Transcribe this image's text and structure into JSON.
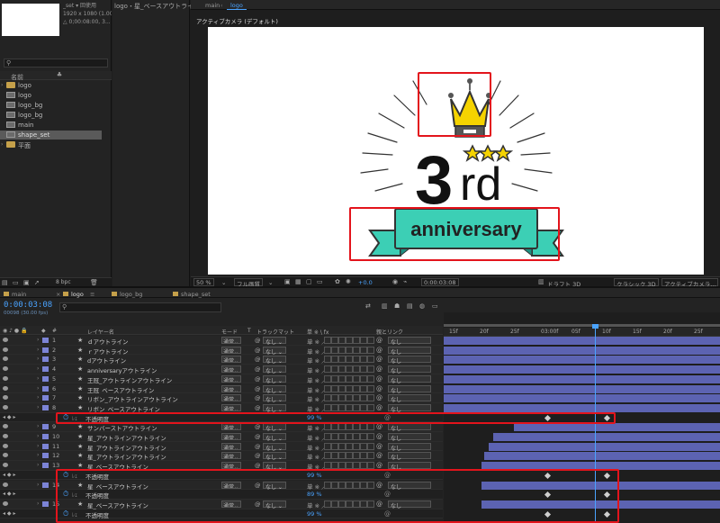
{
  "project": {
    "meta": [
      "_set ▾ 回使用",
      "1920 x 1080 (1.00)",
      "△ 0;00:08:00, 3..."
    ],
    "column_name": "名前",
    "items": [
      {
        "type": "folder",
        "label": "logo",
        "twirl": "›"
      },
      {
        "type": "comp",
        "label": "logo",
        "twirl": ""
      },
      {
        "type": "comp",
        "label": "logo_bg",
        "twirl": ""
      },
      {
        "type": "comp",
        "label": "logo_bg",
        "twirl": ""
      },
      {
        "type": "comp",
        "label": "main",
        "twirl": ""
      },
      {
        "type": "comp",
        "label": "shape_set",
        "twirl": "",
        "selected": true
      },
      {
        "type": "folder",
        "label": "平面",
        "twirl": "›"
      }
    ],
    "bpc": "8 bpc"
  },
  "effects": {
    "title": "logo・星_ベースアウトライン"
  },
  "viewer": {
    "tabs": [
      "main",
      "logo"
    ],
    "active_tab": "logo",
    "camera_label": "アクティブカメラ (デフォルト)",
    "zoom": "50 %",
    "resolution": "フル画質",
    "exposure": "+0.0",
    "time": "0:00:03:08",
    "renderer": "ドラフト 3D",
    "renderer_mode": "クラシック 3D",
    "camera_select": "アクティブカメラ...",
    "artwork": {
      "numeral": "3",
      "suffix": "rd",
      "banner": "anniversary"
    }
  },
  "timeline": {
    "tabs": [
      {
        "label": "main",
        "active": false
      },
      {
        "label": "logo",
        "active": true
      },
      {
        "label": "logo_bg",
        "active": false
      },
      {
        "label": "shape_set",
        "active": false
      }
    ],
    "timecode": "0:00:03:08",
    "fps": "00098 (30.00 fps)",
    "columns": {
      "num": "#",
      "name": "レイヤー名",
      "mode": "モード",
      "t": "T",
      "track": "トラックマット",
      "switches": "単 ※ \\ fx",
      "parent": "親とリンク"
    },
    "ruler": [
      "15f",
      "20f",
      "25f",
      "03:00f",
      "05f",
      "10f",
      "15f",
      "20f",
      "25f"
    ],
    "rows": [
      {
        "kind": "layer",
        "num": "1",
        "name": "ｄアウトライン",
        "mode": "通常",
        "track": "なし",
        "switch": "单 ※ ／",
        "parent": "なし"
      },
      {
        "kind": "layer",
        "num": "2",
        "name": "ｒアウトライン",
        "mode": "通常",
        "track": "なし",
        "switch": "单 ※ ／",
        "parent": "なし"
      },
      {
        "kind": "layer",
        "num": "3",
        "name": "dアウトライン",
        "mode": "通常",
        "track": "なし",
        "switch": "单 ※ ／",
        "parent": "なし"
      },
      {
        "kind": "layer",
        "num": "4",
        "name": "anniversaryアウトライン",
        "mode": "通常",
        "track": "なし",
        "switch": "单 ※ ／",
        "parent": "なし"
      },
      {
        "kind": "layer",
        "num": "5",
        "name": "王冠_アウトラインアウトライン",
        "mode": "通常",
        "track": "なし",
        "switch": "单 ※ ／",
        "parent": "なし"
      },
      {
        "kind": "layer",
        "num": "6",
        "name": "王冠_ベースアウトライン",
        "mode": "通常",
        "track": "なし",
        "switch": "单 ※ ／",
        "parent": "なし"
      },
      {
        "kind": "layer",
        "num": "7",
        "name": "リボン_アウトラインアウトライン",
        "mode": "通常",
        "track": "なし",
        "switch": "单 ※ ／",
        "parent": "なし"
      },
      {
        "kind": "layer",
        "num": "8",
        "name": "リボン_ベースアウトライン",
        "mode": "通常",
        "track": "なし",
        "switch": "单 ※ ／",
        "parent": "なし"
      },
      {
        "kind": "prop",
        "name": "不透明度",
        "value": "99 %"
      },
      {
        "kind": "layer",
        "num": "9",
        "name": "サンバーストアウトライン",
        "mode": "通常",
        "track": "なし",
        "switch": "单 ※ ／",
        "parent": "なし"
      },
      {
        "kind": "layer",
        "num": "10",
        "name": "星_アウトラインアウトライン",
        "mode": "通常",
        "track": "なし",
        "switch": "单 ※ ／",
        "parent": "なし"
      },
      {
        "kind": "layer",
        "num": "11",
        "name": "星_アウトラインアウトライン",
        "mode": "通常",
        "track": "なし",
        "switch": "单 ※ ／",
        "parent": "なし"
      },
      {
        "kind": "layer",
        "num": "12",
        "name": "星_アウトラインアウトライン",
        "mode": "通常",
        "track": "なし",
        "switch": "单 ※ ／",
        "parent": "なし"
      },
      {
        "kind": "layer",
        "num": "13",
        "name": "星_ベースアウトライン",
        "mode": "通常",
        "track": "なし",
        "switch": "单 ※ ／",
        "parent": "なし"
      },
      {
        "kind": "prop",
        "name": "不透明度",
        "value": "99 %"
      },
      {
        "kind": "layer",
        "num": "14",
        "name": "星_ベースアウトライン",
        "mode": "通常",
        "track": "なし",
        "switch": "单 ※ ／",
        "parent": "なし"
      },
      {
        "kind": "prop",
        "name": "不透明度",
        "value": "89 %"
      },
      {
        "kind": "layer",
        "num": "15",
        "name": "星_ベースアウトライン",
        "mode": "通常",
        "track": "なし",
        "switch": "单 ※ ／",
        "parent": "なし"
      },
      {
        "kind": "prop",
        "name": "不透明度",
        "value": "99 %"
      }
    ]
  },
  "colors": {
    "accent": "#4aa3ff",
    "label": "#7c84d6",
    "highlight": "#e3141c",
    "crown": "#f5d300",
    "banner": "#3ccfb5"
  }
}
